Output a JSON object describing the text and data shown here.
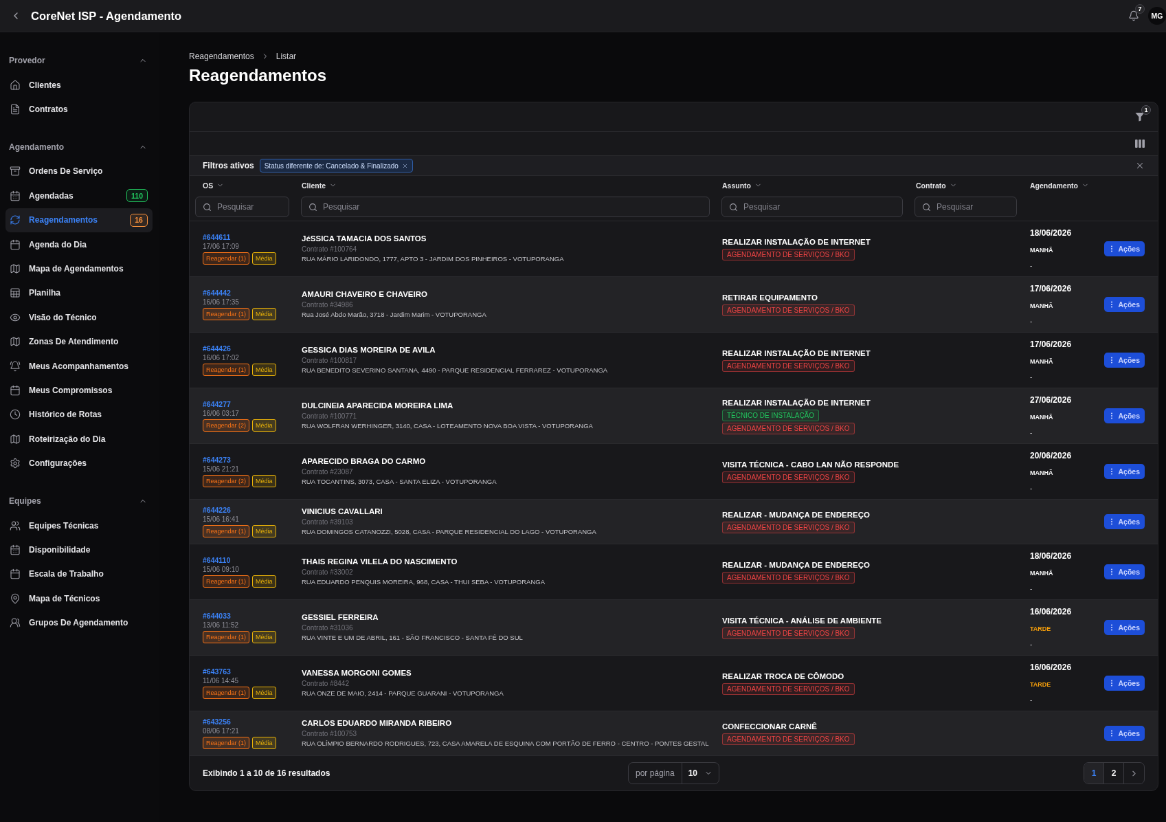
{
  "top_bar": {
    "title": "CoreNet ISP - Agendamento",
    "notifications": "7",
    "avatar": "MG"
  },
  "sidebar": {
    "sections": [
      {
        "title": "Provedor",
        "expanded": true,
        "items": [
          {
            "label": "Clientes",
            "selected": false
          },
          {
            "label": "Contratos",
            "selected": false
          }
        ]
      },
      {
        "title": "Agendamento",
        "expanded": true,
        "items": [
          {
            "label": "Ordens De Serviço",
            "selected": false
          },
          {
            "label": "Agendadas",
            "selected": false,
            "badge": {
              "text": "110",
              "color": "#22c55e"
            }
          },
          {
            "label": "Reagendamentos",
            "selected": true,
            "badge": {
              "text": "16",
              "color": "#fb923c"
            }
          },
          {
            "label": "Agenda do Dia",
            "selected": false
          },
          {
            "label": "Mapa de Agendamentos",
            "selected": false
          },
          {
            "label": "Planilha",
            "selected": false
          },
          {
            "label": "Visão do Técnico",
            "selected": false
          },
          {
            "label": "Zonas De Atendimento",
            "selected": false
          },
          {
            "label": "Meus Acompanhamentos",
            "selected": false
          },
          {
            "label": "Meus Compromissos",
            "selected": false
          },
          {
            "label": "Histórico de Rotas",
            "selected": false
          },
          {
            "label": "Roteirização do Dia",
            "selected": false
          },
          {
            "label": "Configurações",
            "selected": false
          }
        ]
      },
      {
        "title": "Equipes",
        "expanded": true,
        "items": [
          {
            "label": "Equipes Técnicas",
            "selected": false
          },
          {
            "label": "Disponibilidade",
            "selected": false
          },
          {
            "label": "Escala de Trabalho",
            "selected": false
          },
          {
            "label": "Mapa de Técnicos",
            "selected": false
          },
          {
            "label": "Grupos De Agendamento",
            "selected": false
          }
        ]
      }
    ]
  },
  "breadcrumb": [
    "Reagendamentos",
    "Listar"
  ],
  "page_title": "Reagendamentos",
  "toolbar": {
    "filter_count": "1"
  },
  "active_filters": {
    "label": "Filtros ativos",
    "chips": [
      "Status diferente de: Cancelado & Finalizado"
    ]
  },
  "table": {
    "columns": [
      {
        "label": "OS",
        "search_placeholder": "Pesquisar"
      },
      {
        "label": "Cliente",
        "search_placeholder": "Pesquisar"
      },
      {
        "label": "Assunto",
        "search_placeholder": "Pesquisar"
      },
      {
        "label": "Contrato",
        "search_placeholder": "Pesquisar"
      },
      {
        "label": "Agendamento"
      }
    ],
    "rows": [
      {
        "os": "#644611",
        "created": "17/06 17:09",
        "os_tags": [
          {
            "label": "Reagendar (1)",
            "color": "#f97316"
          },
          {
            "label": "Média",
            "color": "#eab308"
          }
        ],
        "client": "JéSSICA TAMACIA DOS SANTOS",
        "contract": "Contrato #100764",
        "address": "RUA MÁRIO LARIDONDO, 1777, APTO 3 - JARDIM DOS PINHEIROS - VOTUPORANGA",
        "subject": "REALIZAR INSTALAÇÃO DE INTERNET",
        "subject_tags": [
          {
            "label": "AGENDAMENTO DE SERVIÇOS / BKO",
            "color": "#ef4444"
          }
        ],
        "schedule": {
          "date": "18/06/2026",
          "shift": {
            "label": "MANHÃ",
            "kind": "morning"
          },
          "note": "-"
        },
        "action": "Ações"
      },
      {
        "os": "#644442",
        "created": "16/06 17:35",
        "os_tags": [
          {
            "label": "Reagendar (1)",
            "color": "#f97316"
          },
          {
            "label": "Média",
            "color": "#eab308"
          }
        ],
        "client": "AMAURI CHAVEIRO E CHAVEIRO",
        "contract": "Contrato #34986",
        "address": "Rua José Abdo Marão, 3718 - Jardim Marim - VOTUPORANGA",
        "subject": "RETIRAR EQUIPAMENTO",
        "subject_tags": [
          {
            "label": "AGENDAMENTO DE SERVIÇOS / BKO",
            "color": "#ef4444"
          }
        ],
        "schedule": {
          "date": "17/06/2026",
          "shift": {
            "label": "MANHÃ",
            "kind": "morning"
          },
          "note": "-"
        },
        "action": "Ações"
      },
      {
        "os": "#644426",
        "created": "16/06 17:02",
        "os_tags": [
          {
            "label": "Reagendar (1)",
            "color": "#f97316"
          },
          {
            "label": "Média",
            "color": "#eab308"
          }
        ],
        "client": "GESSICA DIAS MOREIRA DE AVILA",
        "contract": "Contrato #100817",
        "address": "RUA BENEDITO SEVERINO SANTANA, 4490 - PARQUE RESIDENCIAL FERRAREZ - VOTUPORANGA",
        "subject": "REALIZAR INSTALAÇÃO DE INTERNET",
        "subject_tags": [
          {
            "label": "AGENDAMENTO DE SERVIÇOS / BKO",
            "color": "#ef4444"
          }
        ],
        "schedule": {
          "date": "17/06/2026",
          "shift": {
            "label": "MANHÃ",
            "kind": "morning"
          },
          "note": "-"
        },
        "action": "Ações"
      },
      {
        "os": "#644277",
        "created": "16/06 03:17",
        "os_tags": [
          {
            "label": "Reagendar (2)",
            "color": "#f97316"
          },
          {
            "label": "Média",
            "color": "#eab308"
          }
        ],
        "client": "DULCINEIA APARECIDA MOREIRA LIMA",
        "contract": "Contrato #100771",
        "address": "RUA WOLFRAN WERHINGER, 3140, CASA - LOTEAMENTO NOVA BOA VISTA - VOTUPORANGA",
        "subject": "REALIZAR INSTALAÇÃO DE INTERNET",
        "subject_tags": [
          {
            "label": "TÉCNICO DE INSTALAÇÃO",
            "color": "#22c55e"
          },
          {
            "label": "AGENDAMENTO DE SERVIÇOS / BKO",
            "color": "#ef4444"
          }
        ],
        "schedule": {
          "date": "27/06/2026",
          "shift": {
            "label": "MANHÃ",
            "kind": "morning"
          },
          "note": "-"
        },
        "action": "Ações"
      },
      {
        "os": "#644273",
        "created": "15/06 21:21",
        "os_tags": [
          {
            "label": "Reagendar (2)",
            "color": "#f97316"
          },
          {
            "label": "Média",
            "color": "#eab308"
          }
        ],
        "client": "APARECIDO BRAGA DO CARMO",
        "contract": "Contrato #23087",
        "address": "RUA TOCANTINS, 3073, CASA - SANTA ELIZA - VOTUPORANGA",
        "subject": "VISITA TÉCNICA - CABO LAN NÃO RESPONDE",
        "subject_tags": [
          {
            "label": "AGENDAMENTO DE SERVIÇOS / BKO",
            "color": "#ef4444"
          }
        ],
        "schedule": {
          "date": "20/06/2026",
          "shift": {
            "label": "MANHÃ",
            "kind": "morning"
          },
          "note": "-"
        },
        "action": "Ações"
      },
      {
        "os": "#644226",
        "created": "15/06 16:41",
        "os_tags": [
          {
            "label": "Reagendar (1)",
            "color": "#f97316"
          },
          {
            "label": "Média",
            "color": "#eab308"
          }
        ],
        "client": "VINICIUS CAVALLARI",
        "contract": "Contrato #39103",
        "address": "RUA DOMINGOS CATANOZZI, 5028, CASA - PARQUE RESIDENCIAL DO LAGO - VOTUPORANGA",
        "subject": "REALIZAR - MUDANÇA DE ENDEREÇO",
        "subject_tags": [
          {
            "label": "AGENDAMENTO DE SERVIÇOS / BKO",
            "color": "#ef4444"
          }
        ],
        "action": "Ações"
      },
      {
        "os": "#644110",
        "created": "15/06 09:10",
        "os_tags": [
          {
            "label": "Reagendar (1)",
            "color": "#f97316"
          },
          {
            "label": "Média",
            "color": "#eab308"
          }
        ],
        "client": "THAIS REGINA VILELA DO NASCIMENTO",
        "contract": "Contrato #33002",
        "address": "RUA EDUARDO PENQUIS MOREIRA, 968, CASA - THUI SEBA - VOTUPORANGA",
        "subject": "REALIZAR - MUDANÇA DE ENDEREÇO",
        "subject_tags": [
          {
            "label": "AGENDAMENTO DE SERVIÇOS / BKO",
            "color": "#ef4444"
          }
        ],
        "schedule": {
          "date": "18/06/2026",
          "shift": {
            "label": "MANHÃ",
            "kind": "morning"
          },
          "note": "-"
        },
        "action": "Ações"
      },
      {
        "os": "#644033",
        "created": "13/06 11:52",
        "os_tags": [
          {
            "label": "Reagendar (1)",
            "color": "#f97316"
          },
          {
            "label": "Média",
            "color": "#eab308"
          }
        ],
        "client": "GESSIEL FERREIRA",
        "contract": "Contrato #31036",
        "address": "RUA VINTE E UM DE ABRIL, 161 - SÃO FRANCISCO - SANTA FÉ DO SUL",
        "subject": "VISITA TÉCNICA - ANÁLISE DE AMBIENTE",
        "subject_tags": [
          {
            "label": "AGENDAMENTO DE SERVIÇOS / BKO",
            "color": "#ef4444"
          }
        ],
        "schedule": {
          "date": "16/06/2026",
          "shift": {
            "label": "TARDE",
            "kind": "afternoon"
          },
          "note": "-"
        },
        "action": "Ações"
      },
      {
        "os": "#643763",
        "created": "11/06 14:45",
        "os_tags": [
          {
            "label": "Reagendar (1)",
            "color": "#f97316"
          },
          {
            "label": "Média",
            "color": "#eab308"
          }
        ],
        "client": "VANESSA MORGONI GOMES",
        "contract": "Contrato #8442",
        "address": "RUA ONZE DE MAIO, 2414 - PARQUE GUARANI - VOTUPORANGA",
        "subject": "REALIZAR TROCA DE CÔMODO",
        "subject_tags": [
          {
            "label": "AGENDAMENTO DE SERVIÇOS / BKO",
            "color": "#ef4444"
          }
        ],
        "schedule": {
          "date": "16/06/2026",
          "shift": {
            "label": "TARDE",
            "kind": "afternoon"
          },
          "note": "-"
        },
        "action": "Ações"
      },
      {
        "os": "#643256",
        "created": "08/06 17:21",
        "os_tags": [
          {
            "label": "Reagendar (1)",
            "color": "#f97316"
          },
          {
            "label": "Média",
            "color": "#eab308"
          }
        ],
        "client": "CARLOS EDUARDO MIRANDA RIBEIRO",
        "contract": "Contrato #100753",
        "address": "RUA OLÍMPIO BERNARDO RODRIGUES, 723, CASA AMARELA DE ESQUINA COM PORTÃO DE FERRO - CENTRO - PONTES GESTAL",
        "subject": "CONFECCIONAR CARNÊ",
        "subject_tags": [
          {
            "label": "AGENDAMENTO DE SERVIÇOS / BKO",
            "color": "#ef4444"
          }
        ],
        "action": "Ações"
      }
    ]
  },
  "footer": {
    "summary": "Exibindo 1 a 10 de 16 resultados",
    "per_page_label": "por página",
    "per_page": "10",
    "pages": [
      {
        "label": "1",
        "selected": true
      },
      {
        "label": "2",
        "selected": false
      }
    ]
  }
}
